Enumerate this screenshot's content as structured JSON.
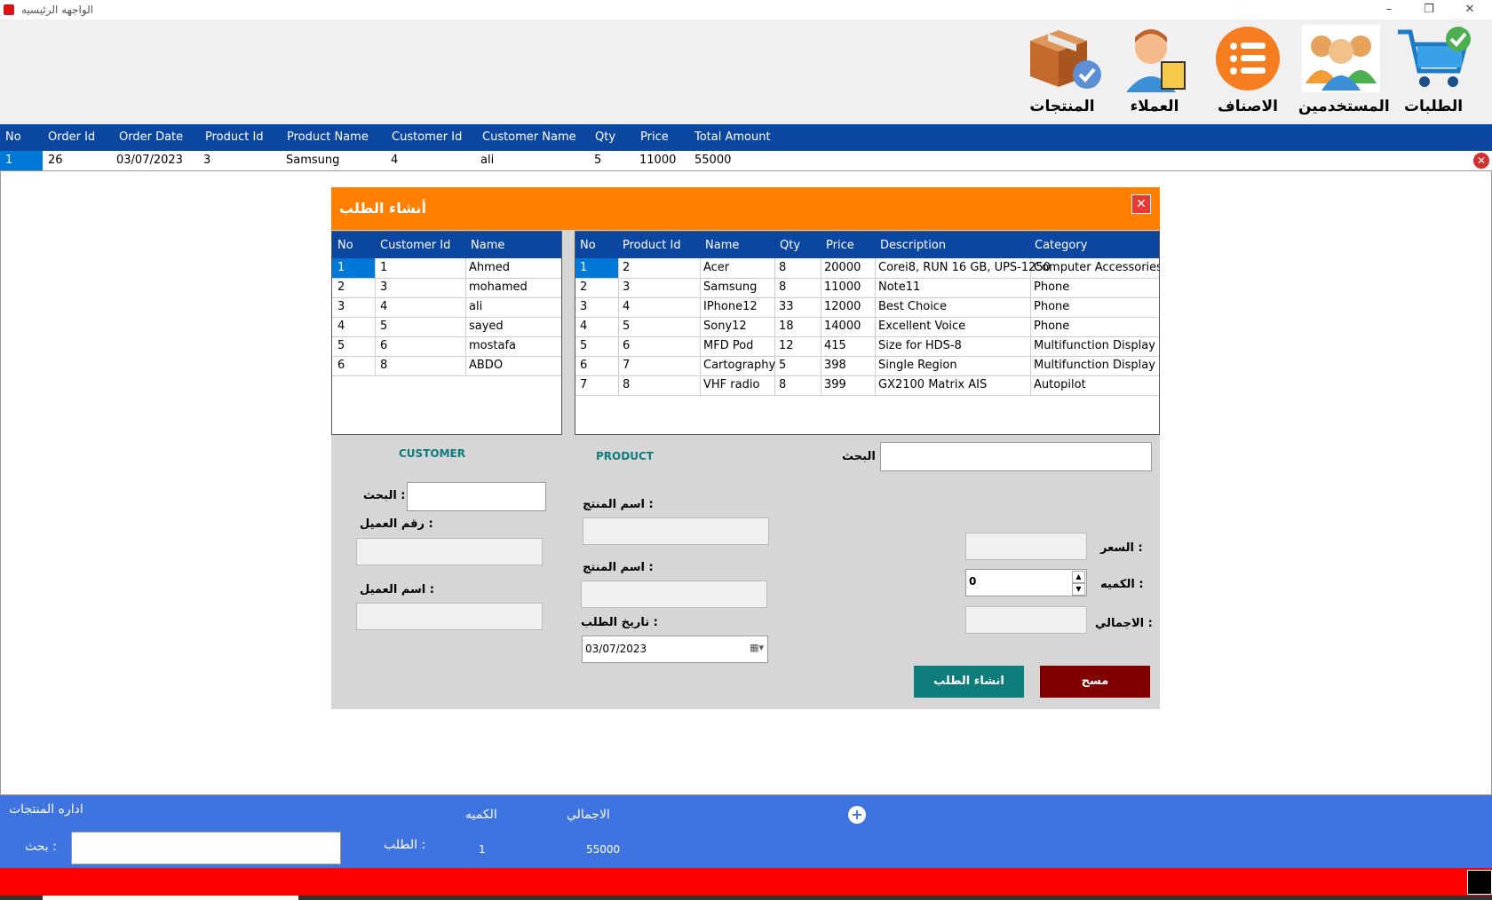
{
  "window": {
    "title": "الواجهه الرئيسيه"
  },
  "nav": [
    {
      "label": "الطلبات",
      "icon": "cart-icon"
    },
    {
      "label": "المستخدمين",
      "icon": "users-icon"
    },
    {
      "label": "الاصناف",
      "icon": "list-icon"
    },
    {
      "label": "العملاء",
      "icon": "customer-icon"
    },
    {
      "label": "المنتجات",
      "icon": "box-icon"
    }
  ],
  "orders": {
    "headers": [
      "No",
      "Order Id",
      "Order Date",
      "Product Id",
      "Product Name",
      "Customer Id",
      "Customer Name",
      "Qty",
      "Price",
      "Total Amount"
    ],
    "rows": [
      [
        "1",
        "26",
        "03/07/2023",
        "3",
        "Samsung",
        "4",
        "ali",
        "5",
        "11000",
        "55000"
      ]
    ]
  },
  "dialog": {
    "title": "أنشاء الطلب",
    "customers": {
      "headers": [
        "No",
        "Customer Id",
        "Name"
      ],
      "rows": [
        [
          "1",
          "1",
          "Ahmed"
        ],
        [
          "2",
          "3",
          "mohamed"
        ],
        [
          "3",
          "4",
          "ali"
        ],
        [
          "4",
          "5",
          "sayed"
        ],
        [
          "5",
          "6",
          "mostafa"
        ],
        [
          "6",
          "8",
          "ABDO"
        ]
      ]
    },
    "products": {
      "headers": [
        "No",
        "Product Id",
        "Name",
        "Qty",
        "Price",
        "Description",
        "Category"
      ],
      "rows": [
        [
          "1",
          "2",
          "Acer",
          "8",
          "20000",
          "Corei8, RUN 16 GB, UPS-1250",
          "Computer Accessories"
        ],
        [
          "2",
          "3",
          "Samsung",
          "8",
          "11000",
          "Note11",
          "Phone"
        ],
        [
          "3",
          "4",
          "IPhone12",
          "33",
          "12000",
          "Best Choice",
          "Phone"
        ],
        [
          "4",
          "5",
          "Sony12",
          "18",
          "14000",
          "Excellent Voice",
          "Phone"
        ],
        [
          "5",
          "6",
          "MFD Pod",
          "12",
          "415",
          "Size for HDS-8",
          "Multifunction Display"
        ],
        [
          "6",
          "7",
          "Cartography",
          "5",
          "398",
          "Single Region",
          "Multifunction Display"
        ],
        [
          "7",
          "8",
          "VHF radio",
          "8",
          "399",
          "GX2100 Matrix AIS",
          "Autopilot"
        ]
      ]
    },
    "customer_caption": "CUSTOMER",
    "product_caption": "PRODUCT",
    "search_label": ": البحث",
    "customer_search_label": ": البحث",
    "customer_no_label": ": رقم العميل",
    "customer_name_label": ": اسم العميل",
    "product_name_label_1": ": اسم المنتج",
    "product_name_label_2": ": اسم المنتج",
    "order_date_label": ": تاريخ الطلب",
    "order_date_value": "03/07/2023",
    "price_label": ": السعر",
    "qty_label": ": الكميه",
    "qty_value": "0",
    "total_label": ": الاجمالي",
    "create_button": "انشاء الطلب",
    "clear_button": "مسح"
  },
  "footer": {
    "title": "اداره المنتجات",
    "search_label": ": بحث",
    "order_label": ": الطلب",
    "qty_header": "الكميه",
    "total_header": "الاجمالي",
    "qty_value": "1",
    "total_value": "55000"
  },
  "colors": {
    "header_blue": "#0b47a1",
    "orange": "#ff7f00",
    "teal": "#0e7c7b",
    "maroon": "#800000",
    "footer_blue": "#3f73e0",
    "red": "#ff0000"
  }
}
